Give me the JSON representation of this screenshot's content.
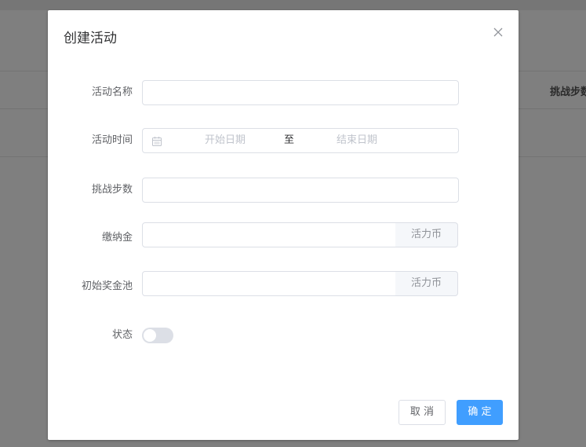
{
  "background": {
    "header_cell": "挑战步数"
  },
  "dialog": {
    "title": "创建活动",
    "close_icon": "close-icon",
    "fields": {
      "name": {
        "label": "活动名称",
        "value": ""
      },
      "time": {
        "label": "活动时间",
        "start_placeholder": "开始日期",
        "separator": "至",
        "end_placeholder": "结束日期"
      },
      "steps": {
        "label": "挑战步数",
        "value": ""
      },
      "fee": {
        "label": "缴纳金",
        "value": "",
        "unit": "活力币"
      },
      "pool": {
        "label": "初始奖金池",
        "value": "",
        "unit": "活力币"
      },
      "status": {
        "label": "状态",
        "on": false
      }
    },
    "buttons": {
      "cancel": "取 消",
      "ok": "确 定"
    }
  },
  "colors": {
    "primary": "#409eff",
    "border": "#dcdfe6",
    "placeholder": "#c0c4cc",
    "label": "#606266"
  }
}
